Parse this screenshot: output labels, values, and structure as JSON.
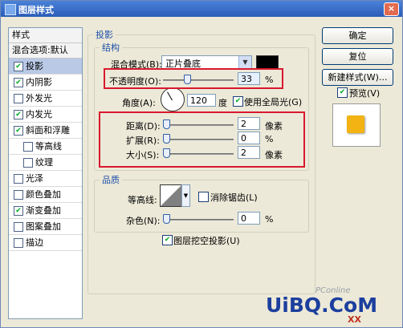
{
  "window": {
    "title": "图层样式",
    "close_label": "×"
  },
  "left_panel": {
    "header": "样式",
    "blend_header": "混合选项:默认",
    "items": [
      {
        "label": "投影",
        "checked": true,
        "selected": true
      },
      {
        "label": "内阴影",
        "checked": true
      },
      {
        "label": "外发光",
        "checked": false
      },
      {
        "label": "内发光",
        "checked": true
      },
      {
        "label": "斜面和浮雕",
        "checked": true
      },
      {
        "label": "等高线",
        "checked": false
      },
      {
        "label": "纹理",
        "checked": false
      },
      {
        "label": "光泽",
        "checked": false
      },
      {
        "label": "颜色叠加",
        "checked": false
      },
      {
        "label": "渐变叠加",
        "checked": true
      },
      {
        "label": "图案叠加",
        "checked": false
      },
      {
        "label": "描边",
        "checked": false
      }
    ]
  },
  "main": {
    "section_title": "投影",
    "structure": {
      "title": "结构",
      "blend_mode_label": "混合模式(B):",
      "blend_mode_value": "正片叠底",
      "blend_color": "#000000",
      "opacity_label": "不透明度(O):",
      "opacity_value": "33",
      "opacity_unit": "%",
      "opacity_percent": 33,
      "angle_label": "角度(A):",
      "angle_value": "120",
      "angle_unit": "度",
      "global_light_label": "使用全局光(G)",
      "global_light_checked": true,
      "distance_label": "距离(D):",
      "distance_value": "2",
      "distance_unit": "像素",
      "spread_label": "扩展(R):",
      "spread_value": "0",
      "spread_unit": "%",
      "size_label": "大小(S):",
      "size_value": "2",
      "size_unit": "像素"
    },
    "quality": {
      "title": "品质",
      "contour_label": "等高线:",
      "antialias_label": "消除锯齿(L)",
      "noise_label": "杂色(N):",
      "noise_value": "0",
      "noise_unit": "%",
      "knockout_label": "图层挖空投影(U)",
      "knockout_checked": true
    }
  },
  "right_panel": {
    "ok_label": "确定",
    "reset_label": "复位",
    "new_style_label": "新建样式(W)...",
    "preview_label": "预览(V)",
    "preview_checked": true,
    "preview_swatch_color": "#f2b313"
  },
  "watermarks": {
    "pconline": "PConline",
    "uibq": "UiBQ.CoM",
    "xx": "XX"
  },
  "colors": {
    "highlight": "#d9182e",
    "accent": "#1c4ea8"
  }
}
